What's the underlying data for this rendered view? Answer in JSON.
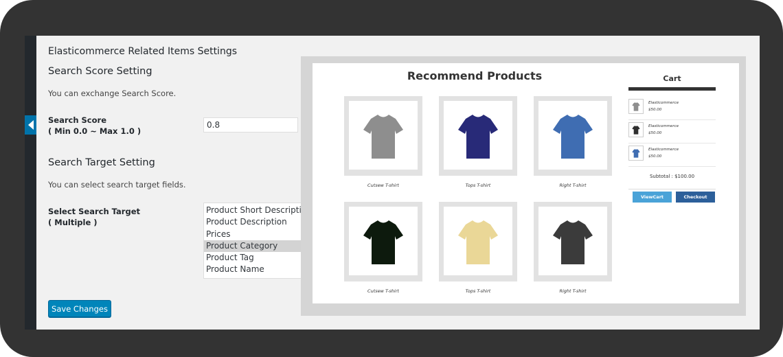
{
  "settings": {
    "page_heading": "Elasticommerce Related Items Settings",
    "score_section": {
      "title": "Search Score Setting",
      "description": "You can exchange Search Score.",
      "label_line1": "Search Score",
      "label_line2": "( Min 0.0 ~ Max 1.0 )",
      "value": "0.8"
    },
    "target_section": {
      "title": "Search Target Setting",
      "description": "You can select search target fields.",
      "label_line1": "Select Search Target",
      "label_line2": "( Multiple )",
      "options": [
        {
          "label": "Product Short Description",
          "selected": false
        },
        {
          "label": "Product Description",
          "selected": false
        },
        {
          "label": "Prices",
          "selected": false
        },
        {
          "label": "Product Category",
          "selected": true
        },
        {
          "label": "Product Tag",
          "selected": false
        },
        {
          "label": "Product Name",
          "selected": false
        }
      ]
    },
    "save_label": "Save Changes"
  },
  "preview": {
    "title": "Recommend Products",
    "products": [
      {
        "name": "Cutsew T-shirt",
        "color": "#8e8e8e",
        "icon": "tshirt-icon"
      },
      {
        "name": "Tops T-shirt",
        "color": "#282a78",
        "icon": "tshirt-icon"
      },
      {
        "name": "Right T-shirt",
        "color": "#3f6db2",
        "icon": "tshirt-icon"
      },
      {
        "name": "Cutsew T-shirt",
        "color": "#0d1a0d",
        "icon": "tshirt-icon"
      },
      {
        "name": "Tops T-shirt",
        "color": "#ead797",
        "icon": "tshirt-icon"
      },
      {
        "name": "Right T-shirt",
        "color": "#3b3b3b",
        "icon": "tshirt-icon"
      }
    ],
    "cart": {
      "title": "Cart",
      "items": [
        {
          "name": "Elasticommerce",
          "price": "$50.00",
          "color": "#8e8e8e"
        },
        {
          "name": "Elasticommerce",
          "price": "$50.00",
          "color": "#2f2f2f"
        },
        {
          "name": "Elasticommerce",
          "price": "$50.00",
          "color": "#3f6db2"
        }
      ],
      "subtotal": "Subtotal : $100.00",
      "view_cart_label": "ViewCart",
      "checkout_label": "Checkout"
    }
  },
  "colors": {
    "accent": "#0085ba",
    "admin_bar": "#23282d",
    "device_frame": "#333333"
  }
}
